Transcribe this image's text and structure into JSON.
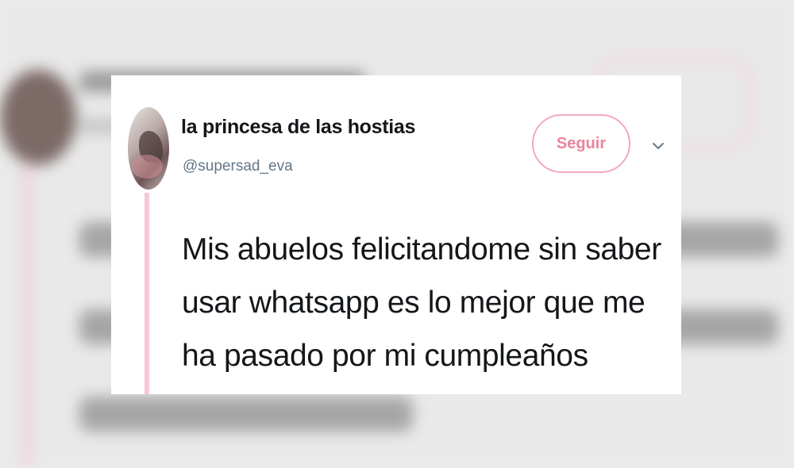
{
  "tweet": {
    "display_name": "la princesa de las hostias",
    "handle": "@supersad_eva",
    "follow_label": "Seguir",
    "text": "Mis abuelos felicitandome sin saber usar whatsapp es lo mejor que me ha pasado por mi cumpleaños"
  },
  "icons": {
    "more": "chevron-down-icon"
  },
  "colors": {
    "accent": "#e8849e",
    "button_border": "#f2a9bf",
    "thread_line": "#f7c9d6",
    "text": "#14171a",
    "secondary_text": "#657786"
  }
}
